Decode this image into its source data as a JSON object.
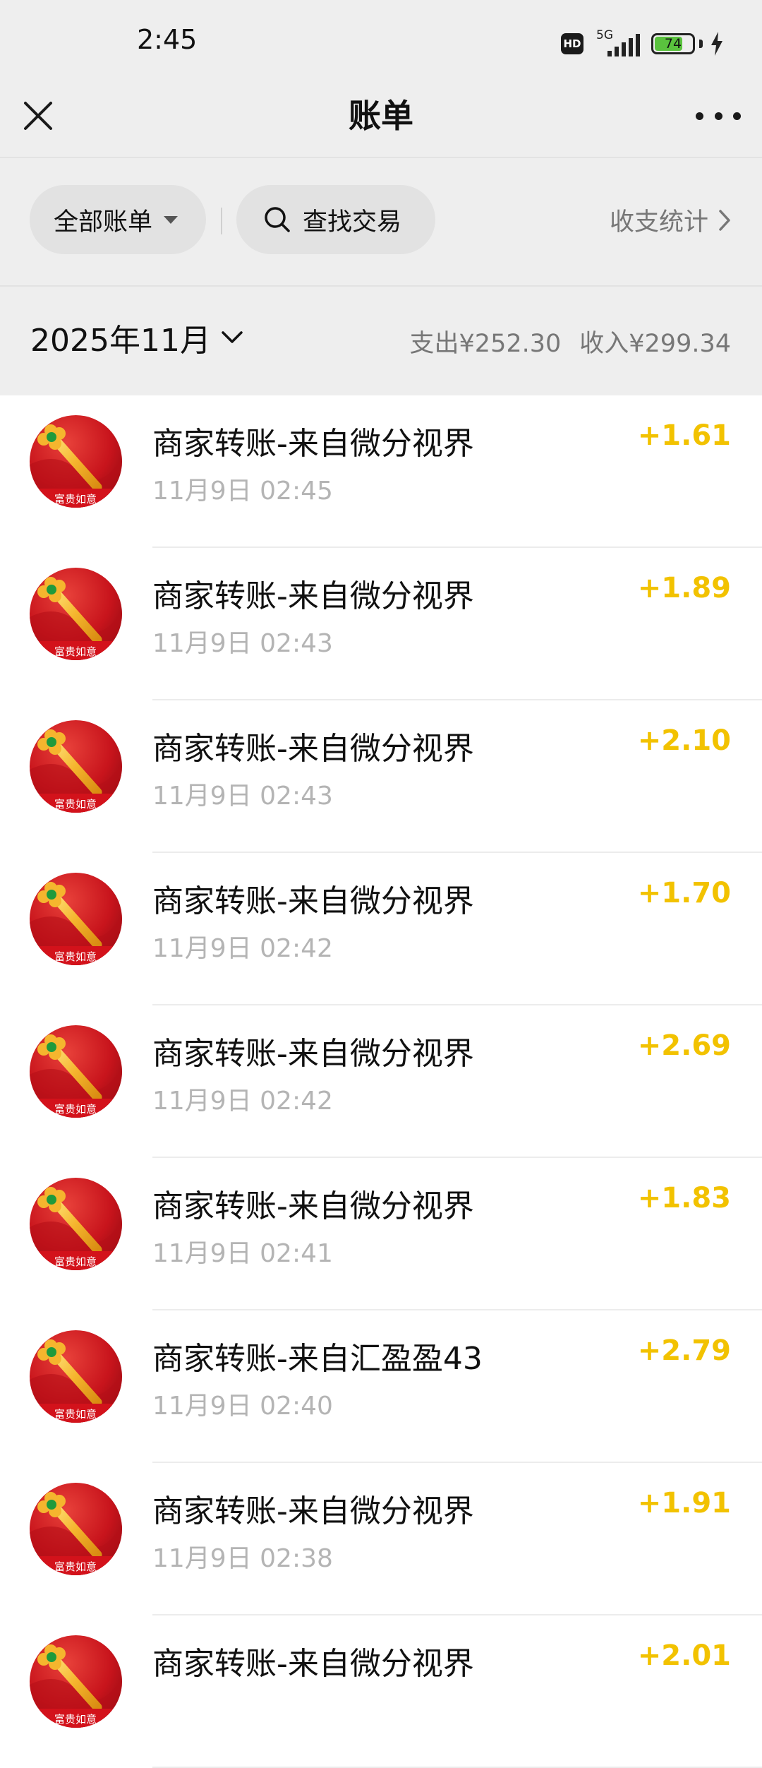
{
  "status_bar": {
    "time": "2:45",
    "hd": "HD",
    "network": "5G",
    "battery": "74"
  },
  "nav": {
    "title": "账单"
  },
  "filters": {
    "all_bills": "全部账单",
    "search": "查找交易",
    "stats": "收支统计"
  },
  "month": {
    "label": "2025年11月",
    "expense": "支出¥252.30",
    "income": "收入¥299.34"
  },
  "avatar_caption": "富贵如意",
  "transactions": [
    {
      "title": "商家转账-来自微分视界",
      "time": "11月9日 02:45",
      "amount": "+1.61"
    },
    {
      "title": "商家转账-来自微分视界",
      "time": "11月9日 02:43",
      "amount": "+1.89"
    },
    {
      "title": "商家转账-来自微分视界",
      "time": "11月9日 02:43",
      "amount": "+2.10"
    },
    {
      "title": "商家转账-来自微分视界",
      "time": "11月9日 02:42",
      "amount": "+1.70"
    },
    {
      "title": "商家转账-来自微分视界",
      "time": "11月9日 02:42",
      "amount": "+2.69"
    },
    {
      "title": "商家转账-来自微分视界",
      "time": "11月9日 02:41",
      "amount": "+1.83"
    },
    {
      "title": "商家转账-来自汇盈盈43",
      "time": "11月9日 02:40",
      "amount": "+2.79"
    },
    {
      "title": "商家转账-来自微分视界",
      "time": "11月9日 02:38",
      "amount": "+1.91"
    },
    {
      "title": "商家转账-来自微分视界",
      "time": "",
      "amount": "+2.01"
    }
  ],
  "colors": {
    "amount": "#f2c200",
    "header_bg": "#eeeeee",
    "secondary_text": "#b4b4b4"
  }
}
